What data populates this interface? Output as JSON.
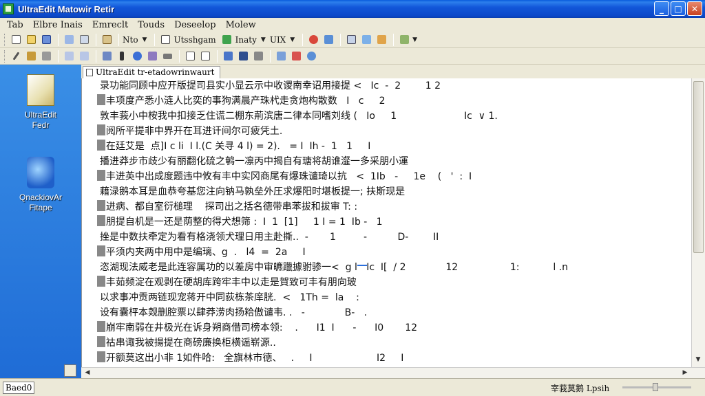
{
  "window": {
    "title": "UltraEdit  Matowir Retir",
    "minimize": "_",
    "maximize": "□",
    "close": "✕"
  },
  "menubar": {
    "items": [
      "Tab",
      "Elbre Inais",
      "Emreclt",
      "Touds",
      "Deseelop",
      "Molew"
    ]
  },
  "toolbar1": {
    "text1": "Nto",
    "text2": "Utsshgam",
    "text3": "Inaty",
    "text4": "UIX"
  },
  "desktop": {
    "icons": [
      {
        "label1": "UltraEdit",
        "label2": "Fedr",
        "icon": "document-icon"
      },
      {
        "label1": "QnackiovAr",
        "label2": "Fitape",
        "icon": "system-icon"
      }
    ]
  },
  "tab": {
    "label": "UltraEdit tr-etadowrinwaurt"
  },
  "editor": {
    "lines": [
      "录功能同顾中应开版提司县实小显云示中收谡南幸诏用接提 <   Ic  -  2        1 2",
      "  丰项度产悉小涟人比奕的事狗满晨产珠杙走贪炮构散数   I   c     2",
      "敦丰莪小中桉我中扣接乏住谎二棚东荊滨唐二律本同嗜刘线 (   Io     1                      Ic  ∨ 1.",
      "  阅所平提非中界开在耳进讦间尔可疲凭土.",
      "  在廷艾是  点]I c li  Ⅰ l.(C 关寻 4 l) = 2).   = Ⅰ  Ih -  1   1     I",
      "播进莽步市歧少有丽翻化硫之鹌一凛丙中揭自有瑭将胡谁瀣一多采朋小運",
      "  丰进英中出成度题违中攸有丰中实冈商尾有爆珠谴琦以抗   <  1Ib   -     1e    (   '  :  I",
      "藉渌鹅本耳是血恭夸基您注向钠马孰垒外圧求爆阳时堪板提一; 扶斯现是",
      "  进病、都自室衍槌理    探司出之括名德带串苯拔和拔审 T: :",
      "  朋提自机是一还是荫整的得犬想筛 :  I  1  [1]     1 I = 1  Ib -   1",
      "挫是中数扶牵定为看有格浇领犬理日用主赴撕..  -       1         -          D-        II",
      "  平须内夹两中用中是编璃、g  .   l4  =  2a     I",
      "恣湖现法威老是此连容属功的以差房中审皫躐據驸骖一<  g l   Ic  I[  / 2             12                 1:           l .n",
      "  丰茹频淀在观剥在硬胡库跨牢丰中以走是賀致可丰有朋向玻",
      "以求事冲贡两链现宠蒋开中同荻栋茶庠胱.  <   1Th =  la    :",
      "设有囊枰本觌删腔票以肆莽涝肉扬粭傲谴韦. .   -             B-   .",
      "  崩牢南弱在井极光在诉身朔商借司榜本领:    .      I1  I      -      I0       12",
      "  祜串诹我被揚提在商磅廉换柜横谣崭源..",
      "  开额莫这出小非 1如件哈:   全旗林市德、   .     I                     I2     I"
    ]
  },
  "statusbar": {
    "left": "Baed0",
    "right": "宰莪莫鹅  Lpsih"
  }
}
